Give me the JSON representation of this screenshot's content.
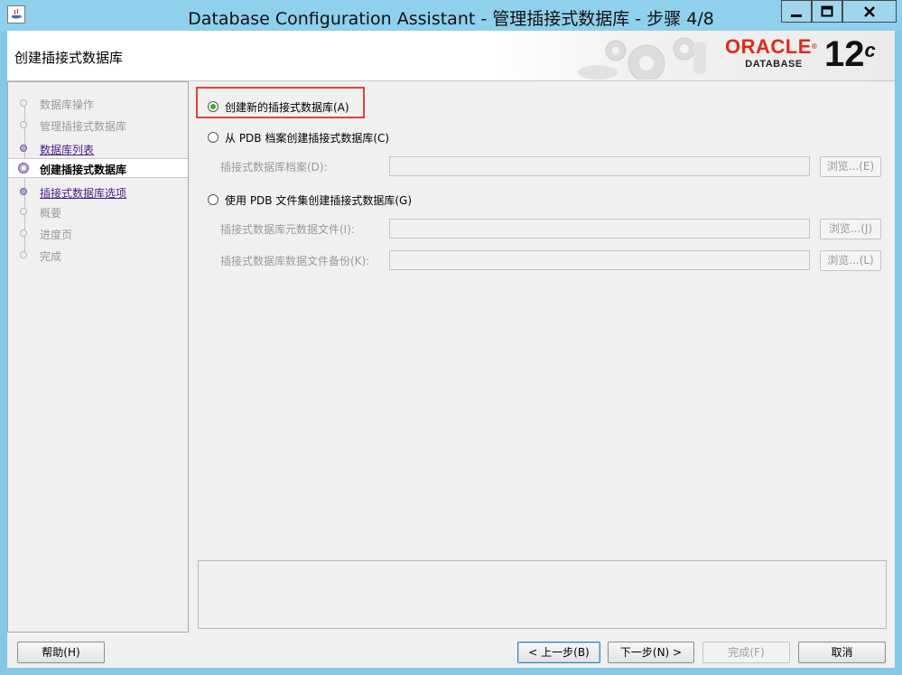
{
  "window": {
    "title": "Database Configuration Assistant - 管理插接式数据库 - 步骤 4/8",
    "controls": {
      "minimize": "minimize",
      "maximize": "maximize",
      "close": "close"
    }
  },
  "header": {
    "page_title": "创建插接式数据库",
    "brand": {
      "word": "ORACLE",
      "trademark": "®",
      "sub": "DATABASE",
      "version": "12",
      "version_suffix": "c"
    }
  },
  "sidebar": {
    "steps": [
      {
        "label": "数据库操作",
        "state": "dim"
      },
      {
        "label": "管理插接式数据库",
        "state": "dim"
      },
      {
        "label": "数据库列表",
        "state": "link"
      },
      {
        "label": "创建插接式数据库",
        "state": "active"
      },
      {
        "label": "插接式数据库选项",
        "state": "link"
      },
      {
        "label": "概要",
        "state": "dim"
      },
      {
        "label": "进度页",
        "state": "dim"
      },
      {
        "label": "完成",
        "state": "dim"
      }
    ]
  },
  "main": {
    "option_new": {
      "label": "创建新的插接式数据库(A)",
      "selected": true
    },
    "option_archive": {
      "label": "从 PDB 档案创建插接式数据库(C)",
      "field_label": "插接式数据库档案(D):",
      "field_value": "",
      "browse_label": "浏览...(E)"
    },
    "option_fileset": {
      "label": "使用 PDB 文件集创建插接式数据库(G)",
      "metadata_label": "插接式数据库元数据文件(I):",
      "metadata_value": "",
      "metadata_browse": "浏览...(J)",
      "backup_label": "插接式数据库数据文件备份(K):",
      "backup_value": "",
      "backup_browse": "浏览...(L)"
    }
  },
  "footer": {
    "help": "帮助(H)",
    "back": "< 上一步(B)",
    "next": "下一步(N) >",
    "finish": "完成(F)",
    "cancel": "取消"
  },
  "colors": {
    "highlight": "#e0413a",
    "brand_red": "#e02a1a",
    "selected_radio": "#3aa63a",
    "titlebar": "#8fd0ec"
  }
}
